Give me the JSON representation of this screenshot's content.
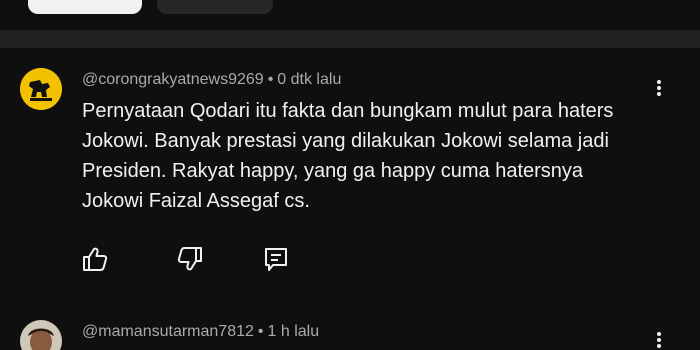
{
  "comments": [
    {
      "author": "@corongrakyatnews9269",
      "separator": "•",
      "time": "0 dtk lalu",
      "text": "Pernyataan Qodari itu fakta dan bungkam mulut para haters Jokowi. Banyak prestasi yang dilakukan Jokowi selama jadi Presiden. Rakyat happy, yang ga happy cuma hatersnya Jokowi Faizal Assegaf cs.",
      "icons": {
        "like": "thumbs-up-icon",
        "dislike": "thumbs-down-icon",
        "reply": "reply-icon",
        "menu": "more-vert-icon"
      }
    },
    {
      "author": "@mamansutarman7812",
      "separator": "•",
      "time": "1 h lalu",
      "icons": {
        "menu": "more-vert-icon"
      }
    }
  ],
  "colors": {
    "background": "#0f0f0f",
    "text": "#f1f1f1",
    "meta": "#aaaaaa",
    "chip_active": "#f1f1f1",
    "chip_inactive": "#272727"
  }
}
